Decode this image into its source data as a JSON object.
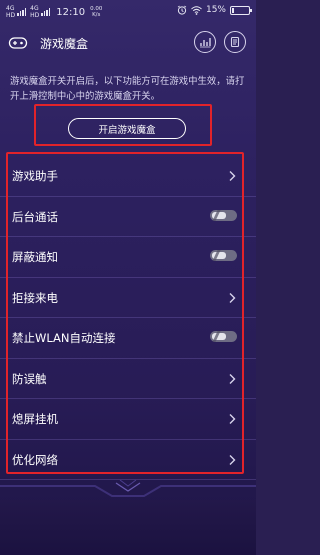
{
  "statusbar": {
    "signal_left": "4G",
    "signal_left_sub": "HD",
    "signal_right": "4G",
    "signal_right_sub": "HD",
    "time": "12:10",
    "speed_value": "0.00",
    "speed_unit": "K/s",
    "battery_text": "15%",
    "battery_level": 0.15
  },
  "header": {
    "title": "游戏魔盒",
    "left_icon": "gamepad-icon",
    "chart_icon": "chart-icon",
    "doc_icon": "document-icon"
  },
  "description": "游戏魔盒开关开启后，以下功能方可在游戏中生效，请打开上滑控制中心中的游戏魔盒开关。",
  "open_button_label": "开启游戏魔盒",
  "settings": {
    "items": [
      {
        "label": "游戏助手",
        "control": "chevron"
      },
      {
        "label": "后台通话",
        "control": "toggle",
        "on": false
      },
      {
        "label": "屏蔽通知",
        "control": "toggle",
        "on": false
      },
      {
        "label": "拒接来电",
        "control": "chevron"
      },
      {
        "label": "禁止WLAN自动连接",
        "control": "toggle",
        "on": false
      },
      {
        "label": "防误触",
        "control": "chevron"
      },
      {
        "label": "熄屏挂机",
        "control": "chevron"
      },
      {
        "label": "优化网络",
        "control": "chevron"
      }
    ]
  },
  "colors": {
    "background": "#2d2160",
    "highlight_border": "#e2232a",
    "toggle_off": "#6e6c84"
  }
}
